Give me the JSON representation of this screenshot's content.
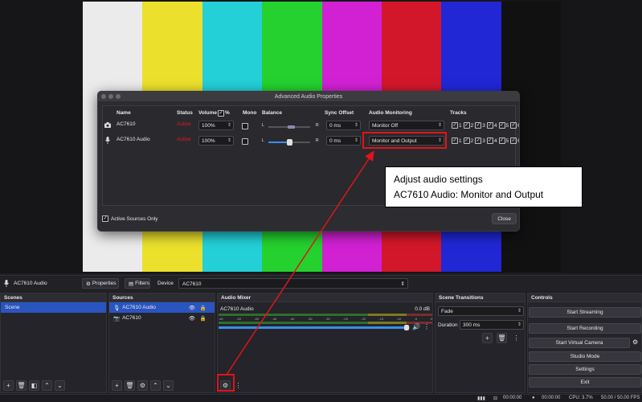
{
  "preview": {
    "bar_colors": [
      "#ebebeb",
      "#ebe02c",
      "#23d0d8",
      "#24d12e",
      "#d121d3",
      "#d3172a",
      "#2127d5",
      "#111111"
    ]
  },
  "dialog": {
    "title": "Advanced Audio Properties",
    "headers": {
      "name": "Name",
      "status": "Status",
      "volume": "Volume",
      "volume_unit": "%",
      "mono": "Mono",
      "balance": "Balance",
      "sync_offset": "Sync Offset",
      "audio_monitoring": "Audio Monitoring",
      "tracks": "Tracks"
    },
    "rows": [
      {
        "icon": "camera-icon",
        "name": "AC7610",
        "status": "Active",
        "volume": "100%",
        "balance_left": "L",
        "balance_right": "R",
        "sync": "0 ms",
        "monitoring": "Monitor Off",
        "tracks": [
          "1",
          "2",
          "3",
          "4",
          "5",
          "6"
        ]
      },
      {
        "icon": "microphone-icon",
        "name": "AC7610 Audio",
        "status": "Active",
        "volume": "100%",
        "balance_left": "L",
        "balance_right": "R",
        "sync": "0 ms",
        "monitoring": "Monitor and Output",
        "tracks": [
          "1",
          "2",
          "3",
          "4",
          "5",
          "6"
        ]
      }
    ],
    "active_sources_only": "Active Sources Only",
    "close": "Close"
  },
  "tooltip": {
    "line1": "Adjust audio settings",
    "line2": "AC7610 Audio: Monitor and Output"
  },
  "source_toolbar": {
    "source_name": "AC7610 Audio",
    "properties": "Properties",
    "filters": "Filters",
    "device_label": "Device",
    "device_value": "AC7610"
  },
  "scenes": {
    "title": "Scenes",
    "items": [
      "Scene"
    ]
  },
  "sources": {
    "title": "Sources",
    "items": [
      "AC7610 Audio",
      "AC7610"
    ]
  },
  "audio_mixer": {
    "title": "Audio Mixer",
    "channel_name": "AC7610 Audio",
    "level": "0.0 dB",
    "scale": [
      "-60",
      "-55",
      "-50",
      "-45",
      "-40",
      "-35",
      "-30",
      "-25",
      "-20",
      "-15",
      "-10",
      "-5",
      "0"
    ]
  },
  "transitions": {
    "title": "Scene Transitions",
    "transition": "Fade",
    "duration_label": "Duration",
    "duration_value": "300 ms"
  },
  "controls": {
    "title": "Controls",
    "buttons": [
      "Start Streaming",
      "Start Recording",
      "Start Virtual Camera",
      "Studio Mode",
      "Settings",
      "Exit"
    ]
  },
  "statusbar": {
    "stream_time": "00:00:00",
    "record_time": "00:00:00",
    "cpu": "CPU: 3.7%",
    "fps": "50.00 / 50.00 FPS"
  },
  "colors": {
    "accent": "#2a55c0",
    "highlight": "#e0141a",
    "active_status": "#e01b1b"
  }
}
